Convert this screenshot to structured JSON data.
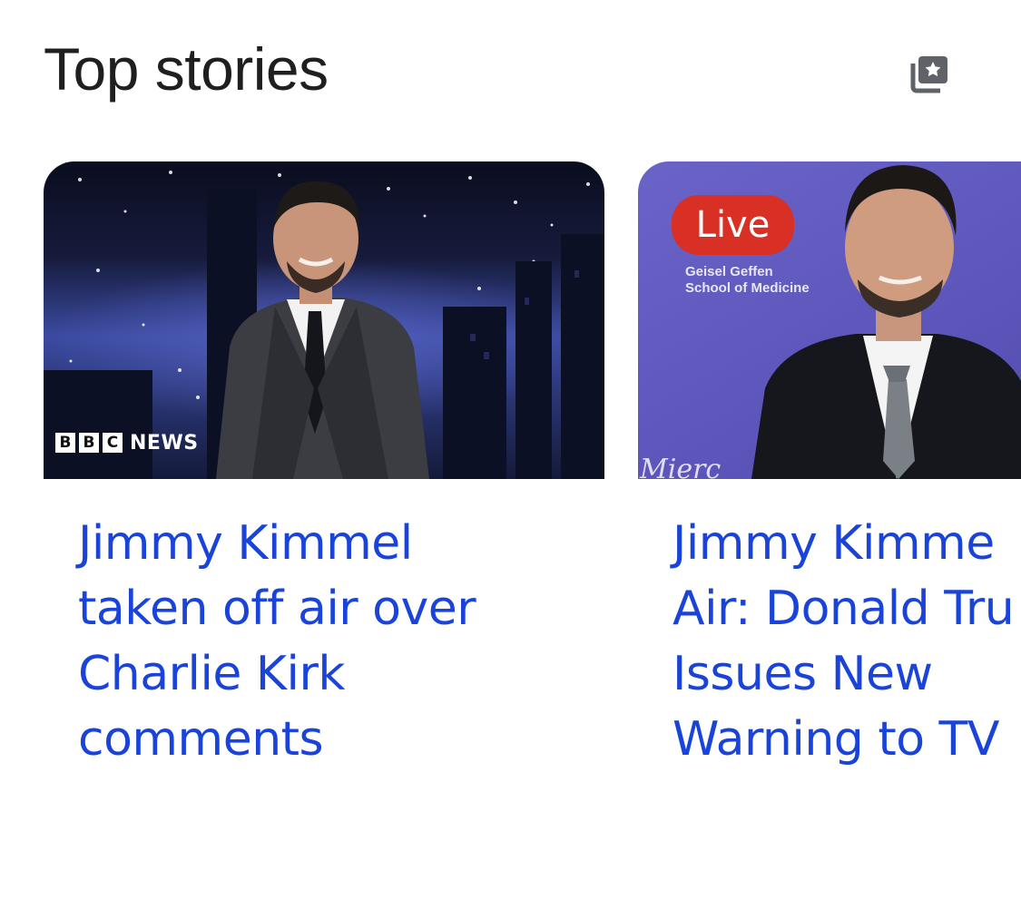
{
  "section": {
    "title": "Top stories",
    "header_icon": "web-stories-icon"
  },
  "stories": [
    {
      "source_logo": {
        "letters": [
          "B",
          "B",
          "C"
        ],
        "text": "NEWS"
      },
      "headline_lines": [
        "Jimmy Kimmel",
        "taken off air over",
        "Charlie Kirk",
        "comments"
      ],
      "image": "jimmy-kimmel-studio-photo"
    },
    {
      "badge": "Live",
      "backdrop_text": [
        "Geisel Geffen",
        "School of Medicine"
      ],
      "backdrop_script": "Mierc",
      "headline_lines": [
        "Jimmy Kimme",
        "Air: Donald Tru",
        "Issues New",
        "Warning to TV"
      ],
      "image": "jimmy-kimmel-event-photo"
    }
  ],
  "colors": {
    "headline": "#1a44d9",
    "title": "#1f1f1f",
    "live_badge": "#d93025"
  }
}
